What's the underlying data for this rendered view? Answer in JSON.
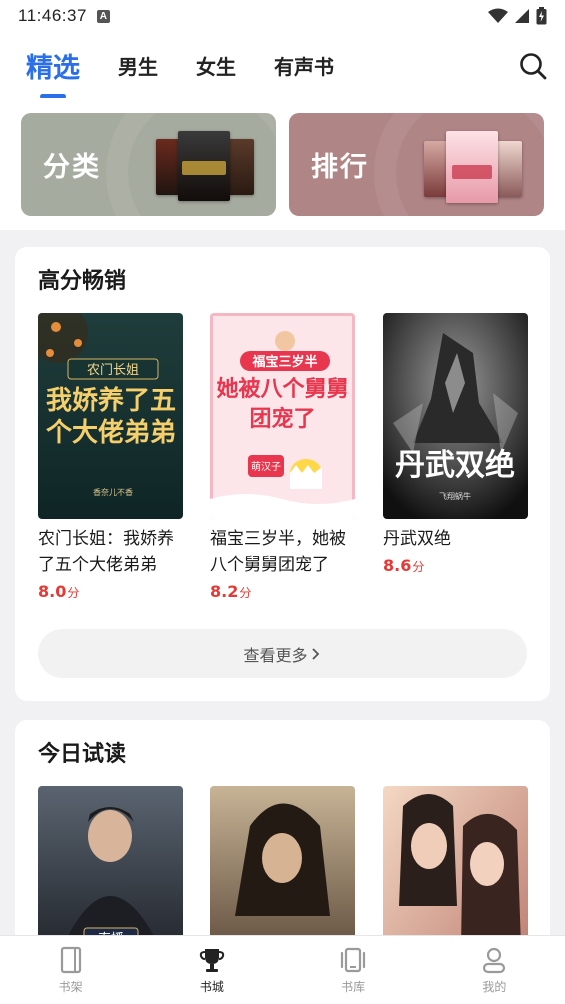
{
  "status_bar": {
    "time": "11:46:37",
    "badge": "A",
    "icons": [
      "wifi-icon",
      "signal-icon",
      "battery-charging-icon"
    ]
  },
  "header": {
    "tabs": [
      {
        "label": "精选",
        "active": true
      },
      {
        "label": "男生",
        "active": false
      },
      {
        "label": "女生",
        "active": false
      },
      {
        "label": "有声书",
        "active": false
      }
    ],
    "search_icon": "search-icon",
    "accent_color": "#2a6fe8"
  },
  "entries": {
    "category": {
      "label": "分类",
      "color": "#a6ab9f"
    },
    "ranking": {
      "label": "排行",
      "color": "#b08586"
    }
  },
  "bestsellers": {
    "title": "高分畅销",
    "books": [
      {
        "title": "农门长姐：我娇养了五个大佬弟弟",
        "score": "8.0",
        "unit": "分",
        "cover_text": [
          "农门长姐",
          "我娇养了五个大佬弟弟"
        ],
        "cover_author": "香奈儿不香"
      },
      {
        "title": "福宝三岁半，她被八个舅舅团宠了",
        "score": "8.2",
        "unit": "分",
        "cover_text": [
          "福宝三岁半",
          "她被八个舅舅团宠了"
        ],
        "cover_author": "萌汉子"
      },
      {
        "title": "丹武双绝",
        "score": "8.6",
        "unit": "分",
        "cover_text": [
          "丹武双绝"
        ],
        "cover_author": "飞翔蜗牛"
      }
    ],
    "more_label": "查看更多",
    "score_color": "#e53935"
  },
  "today_trial": {
    "title": "今日试读",
    "covers": [
      {
        "cover_text": "直播"
      },
      {
        "cover_text": ""
      },
      {
        "cover_text": ""
      }
    ]
  },
  "bottom_nav": {
    "items": [
      {
        "label": "书架",
        "icon": "bookshelf-icon",
        "active": false
      },
      {
        "label": "书城",
        "icon": "trophy-icon",
        "active": true
      },
      {
        "label": "书库",
        "icon": "library-icon",
        "active": false
      },
      {
        "label": "我的",
        "icon": "profile-icon",
        "active": false
      }
    ]
  }
}
